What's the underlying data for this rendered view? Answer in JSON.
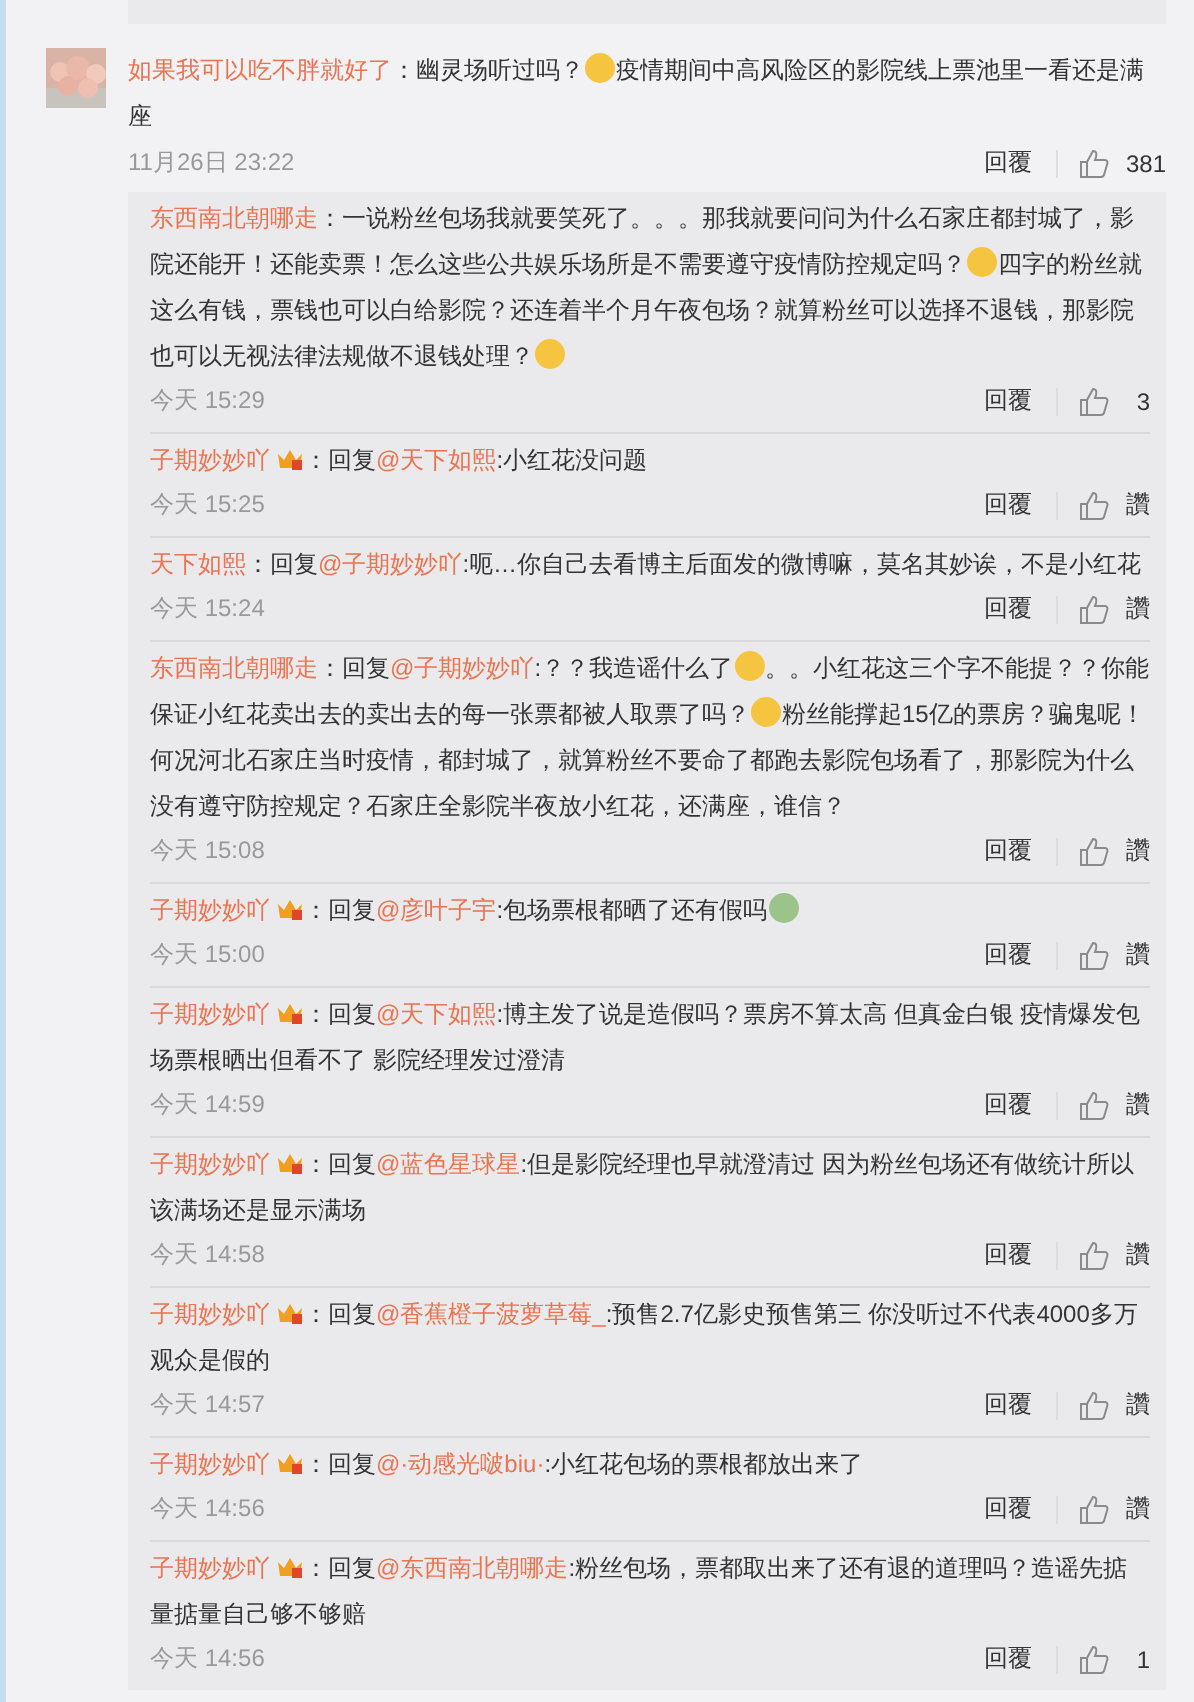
{
  "comment": {
    "user": "如果我可以吃不胖就好了",
    "badge": false,
    "parts": [
      {
        "kind": "text",
        "text": "：幽灵场听过吗？"
      },
      {
        "kind": "emoji",
        "color": "#f5c542"
      },
      {
        "kind": "text",
        "text": "疫情期间中高风险区的影院线上票池里一看还是满座"
      }
    ],
    "time": "11月26日 23:22",
    "reply_label": "回覆",
    "likes": "381"
  },
  "replies": [
    {
      "user": "东西南北朝哪走",
      "badge": false,
      "parts": [
        {
          "kind": "text",
          "text": "：一说粉丝包场我就要笑死了。。。那我就要问问为什么石家庄都封城了，影院还能开！还能卖票！怎么这些公共娱乐场所是不需要遵守疫情防控规定吗？"
        },
        {
          "kind": "emoji",
          "color": "#f5c542"
        },
        {
          "kind": "text",
          "text": "四字的粉丝就这么有钱，票钱也可以白给影院？还连着半个月午夜包场？就算粉丝可以选择不退钱，那影院也可以无视法律法规做不退钱处理？"
        },
        {
          "kind": "emoji",
          "color": "#f5c542"
        }
      ],
      "time": "今天 15:29",
      "reply_label": "回覆",
      "likes": "3"
    },
    {
      "user": "子期妙妙吖",
      "badge": true,
      "parts": [
        {
          "kind": "text",
          "text": "：回复"
        },
        {
          "kind": "mention",
          "text": "@天下如熙"
        },
        {
          "kind": "text",
          "text": ":小红花没问题"
        }
      ],
      "time": "今天 15:25",
      "reply_label": "回覆",
      "likes": "讚"
    },
    {
      "user": "天下如熙",
      "badge": false,
      "parts": [
        {
          "kind": "text",
          "text": "：回复"
        },
        {
          "kind": "mention",
          "text": "@子期妙妙吖"
        },
        {
          "kind": "text",
          "text": ":呃…你自己去看博主后面发的微博嘛，莫名其妙诶，不是小红花"
        }
      ],
      "time": "今天 15:24",
      "reply_label": "回覆",
      "likes": "讚"
    },
    {
      "user": "东西南北朝哪走",
      "badge": false,
      "parts": [
        {
          "kind": "text",
          "text": "：回复"
        },
        {
          "kind": "mention",
          "text": "@子期妙妙吖"
        },
        {
          "kind": "text",
          "text": ":？？我造谣什么了"
        },
        {
          "kind": "emoji",
          "color": "#f5c542"
        },
        {
          "kind": "text",
          "text": "。。小红花这三个字不能提？？你能保证小红花卖出去的卖出去的每一张票都被人取票了吗？"
        },
        {
          "kind": "emoji",
          "color": "#f5c542"
        },
        {
          "kind": "text",
          "text": "粉丝能撑起15亿的票房？骗鬼呢！何况河北石家庄当时疫情，都封城了，就算粉丝不要命了都跑去影院包场看了，那影院为什么没有遵守防控规定？石家庄全影院半夜放小红花，还满座，谁信？"
        }
      ],
      "time": "今天 15:08",
      "reply_label": "回覆",
      "likes": "讚"
    },
    {
      "user": "子期妙妙吖",
      "badge": true,
      "parts": [
        {
          "kind": "text",
          "text": "：回复"
        },
        {
          "kind": "mention",
          "text": "@彦叶子宇"
        },
        {
          "kind": "text",
          "text": ":包场票根都晒了还有假吗"
        },
        {
          "kind": "emoji",
          "color": "#9cc48a"
        }
      ],
      "time": "今天 15:00",
      "reply_label": "回覆",
      "likes": "讚"
    },
    {
      "user": "子期妙妙吖",
      "badge": true,
      "parts": [
        {
          "kind": "text",
          "text": "：回复"
        },
        {
          "kind": "mention",
          "text": "@天下如熙"
        },
        {
          "kind": "text",
          "text": ":博主发了说是造假吗？票房不算太高 但真金白银 疫情爆发包场票根晒出但看不了 影院经理发过澄清"
        }
      ],
      "time": "今天 14:59",
      "reply_label": "回覆",
      "likes": "讚"
    },
    {
      "user": "子期妙妙吖",
      "badge": true,
      "parts": [
        {
          "kind": "text",
          "text": "：回复"
        },
        {
          "kind": "mention",
          "text": "@蓝色星球星"
        },
        {
          "kind": "text",
          "text": ":但是影院经理也早就澄清过 因为粉丝包场还有做统计所以该满场还是显示满场"
        }
      ],
      "time": "今天 14:58",
      "reply_label": "回覆",
      "likes": "讚"
    },
    {
      "user": "子期妙妙吖",
      "badge": true,
      "parts": [
        {
          "kind": "text",
          "text": "：回复"
        },
        {
          "kind": "mention",
          "text": "@香蕉橙子菠萝草莓_"
        },
        {
          "kind": "text",
          "text": ":预售2.7亿影史预售第三 你没听过不代表4000多万观众是假的"
        }
      ],
      "time": "今天 14:57",
      "reply_label": "回覆",
      "likes": "讚"
    },
    {
      "user": "子期妙妙吖",
      "badge": true,
      "parts": [
        {
          "kind": "text",
          "text": "：回复"
        },
        {
          "kind": "mention",
          "text": "@·动感光啵biu·"
        },
        {
          "kind": "text",
          "text": ":小红花包场的票根都放出来了"
        }
      ],
      "time": "今天 14:56",
      "reply_label": "回覆",
      "likes": "讚"
    },
    {
      "user": "子期妙妙吖",
      "badge": true,
      "parts": [
        {
          "kind": "text",
          "text": "：回复"
        },
        {
          "kind": "mention",
          "text": "@东西南北朝哪走"
        },
        {
          "kind": "text",
          "text": ":粉丝包场，票都取出来了还有退的道理吗？造谣先掂量掂量自己够不够赔"
        }
      ],
      "time": "今天 14:56",
      "reply_label": "回覆",
      "likes": "1"
    }
  ]
}
